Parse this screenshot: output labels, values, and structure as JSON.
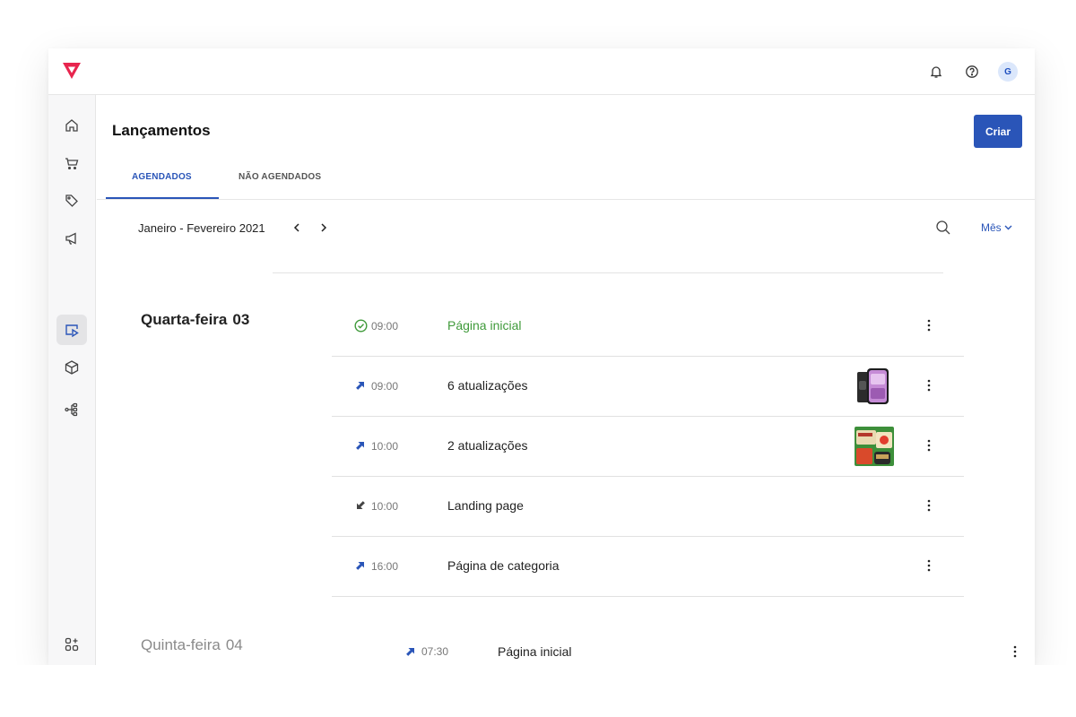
{
  "header": {
    "avatar_initial": "G",
    "icons": [
      "logo",
      "bell-icon",
      "help-icon"
    ]
  },
  "sidebar": {
    "items": [
      {
        "icon": "home-icon",
        "active": false
      },
      {
        "icon": "cart-icon",
        "active": false
      },
      {
        "icon": "tags-icon",
        "active": false
      },
      {
        "icon": "megaphone-icon",
        "active": false
      },
      {
        "icon": "releases-icon",
        "active": true
      },
      {
        "icon": "box-icon",
        "active": false
      },
      {
        "icon": "flow-icon",
        "active": false
      },
      {
        "icon": "apps-icon",
        "active": false
      },
      {
        "icon": "settings-icon",
        "active": false
      }
    ]
  },
  "page": {
    "title": "Lançamentos",
    "create_label": "Criar",
    "tabs": [
      {
        "label": "AGENDADOS",
        "active": true
      },
      {
        "label": "NÃO AGENDADOS",
        "active": false
      }
    ]
  },
  "toolbar": {
    "date_range": "Janeiro - Fevereiro 2021",
    "month_label": "Mês"
  },
  "days": [
    {
      "weekday": "Quarta-feira",
      "day": "03",
      "entries": [
        {
          "status": "published",
          "status_icon": "check-circle-icon",
          "time": "09:00",
          "title": "Página inicial",
          "thumbnail": null
        },
        {
          "status": "scheduled",
          "status_icon": "arrow-up-right-icon",
          "time": "09:00",
          "title": "6 atualizações",
          "thumbnail": "phone-product-thumbnail"
        },
        {
          "status": "scheduled",
          "status_icon": "arrow-up-right-icon",
          "time": "10:00",
          "title": "2 atualizações",
          "thumbnail": "grocery-product-thumbnail"
        },
        {
          "status": "rollback",
          "status_icon": "arrow-down-left-icon",
          "time": "10:00",
          "title": "Landing page",
          "thumbnail": null
        },
        {
          "status": "scheduled",
          "status_icon": "arrow-up-right-icon",
          "time": "16:00",
          "title": "Página de categoria",
          "thumbnail": null
        }
      ]
    },
    {
      "weekday": "Quinta-feira",
      "day": "04",
      "entries": [
        {
          "status": "scheduled",
          "status_icon": "arrow-up-right-icon",
          "time": "07:30",
          "title": "Página inicial",
          "thumbnail": null
        }
      ]
    }
  ],
  "colors": {
    "accent": "#2a55b8",
    "published": "#3f9a3a",
    "brand": "#e8254e"
  }
}
